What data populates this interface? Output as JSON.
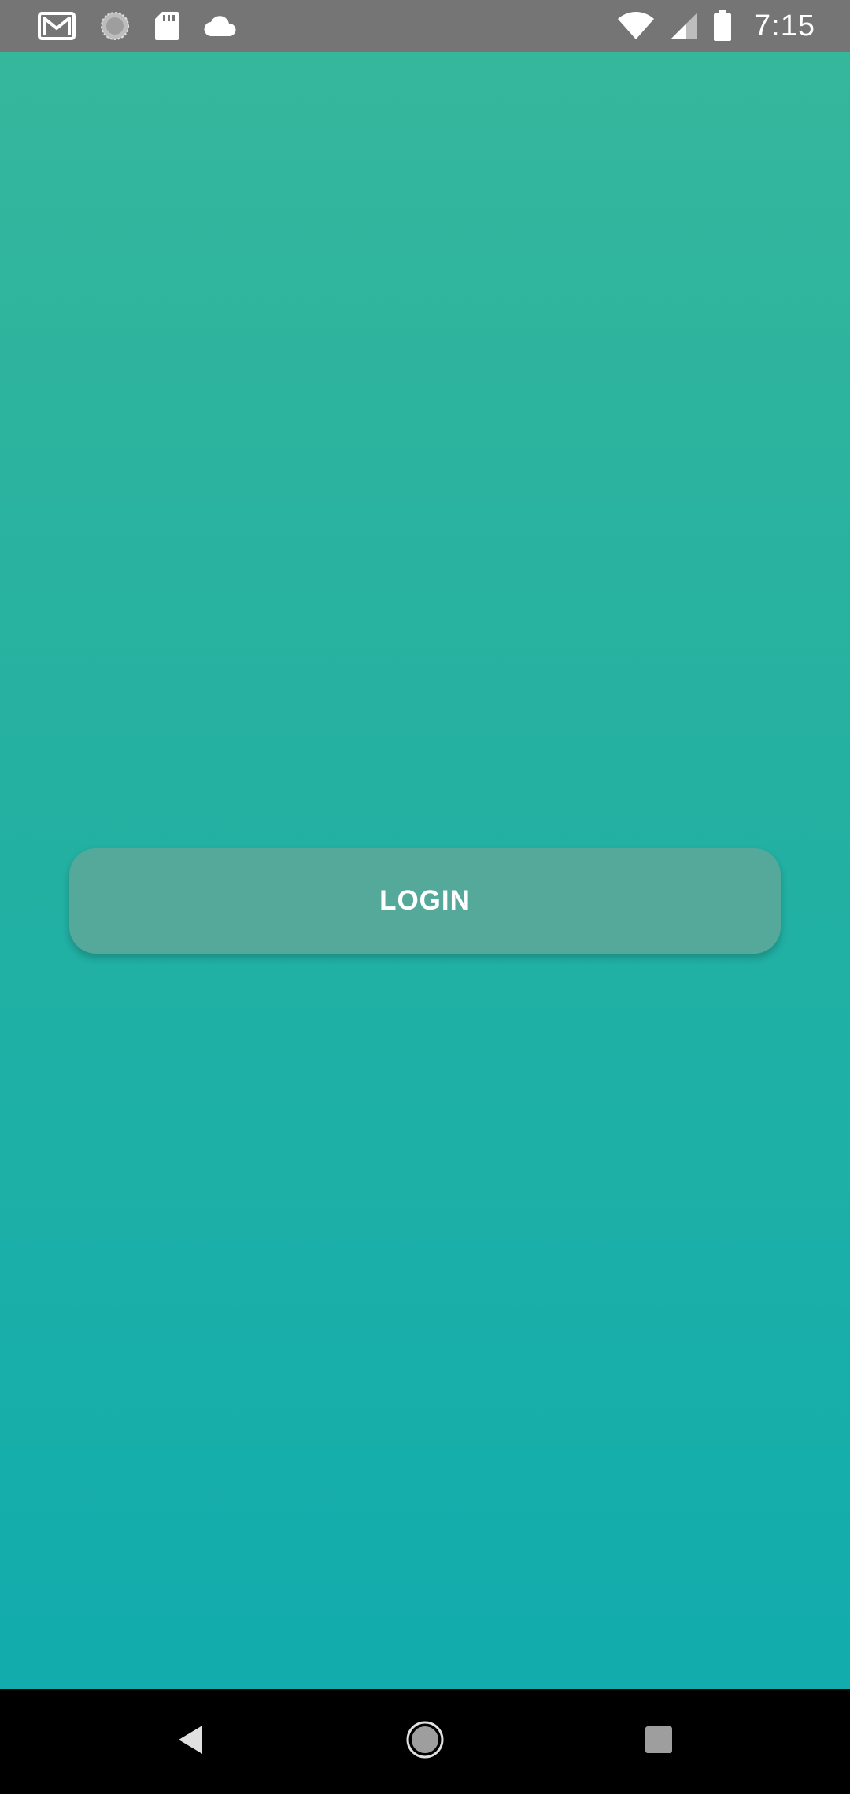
{
  "status_bar": {
    "time": "7:15",
    "left_icons": [
      "gmail-icon",
      "loading-icon",
      "sd-card-icon",
      "cloud-icon"
    ],
    "right_icons": [
      "wifi-icon",
      "signal-icon",
      "battery-icon"
    ],
    "background_color": "#757575"
  },
  "main": {
    "login_label": "LOGIN",
    "gradient_top": "#35b79c",
    "gradient_bottom": "#12acad",
    "button_color": "#55a99b"
  },
  "nav_bar": {
    "icons": [
      "back-icon",
      "home-icon",
      "recents-icon"
    ]
  }
}
